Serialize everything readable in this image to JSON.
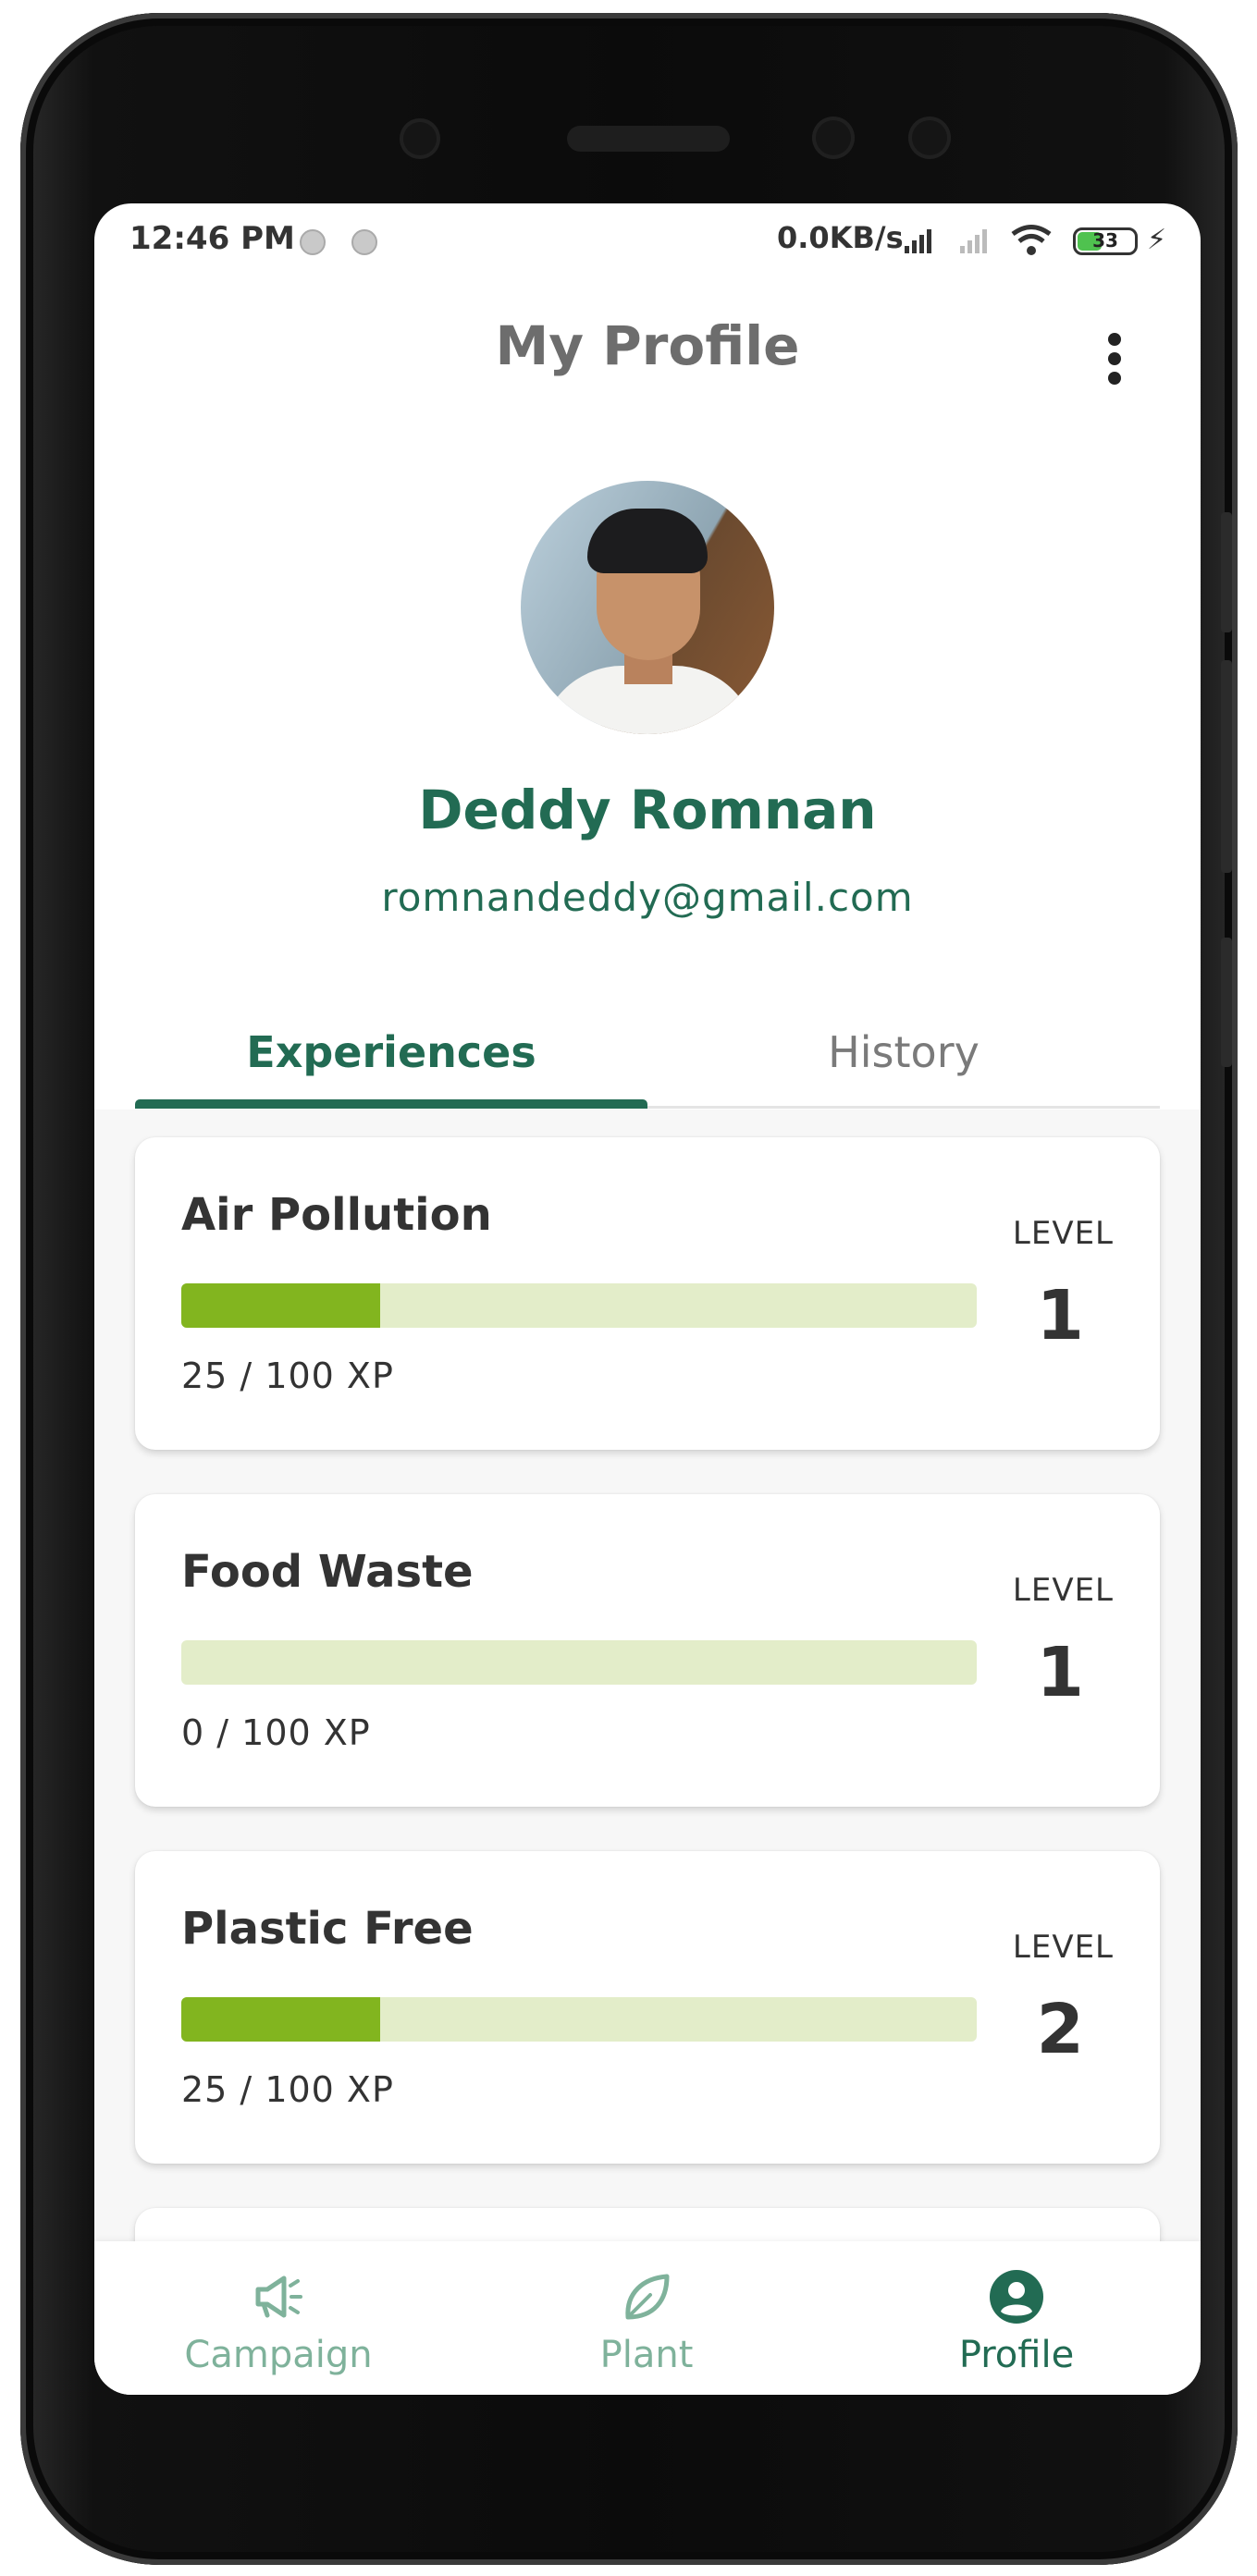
{
  "status_bar": {
    "time": "12:46 PM",
    "net_speed": "0.0KB/s",
    "battery": "33"
  },
  "header": {
    "title": "My Profile"
  },
  "profile": {
    "name": "Deddy Romnan",
    "email": "romnandeddy@gmail.com"
  },
  "tabs": [
    {
      "label": "Experiences",
      "active": true
    },
    {
      "label": "History",
      "active": false
    }
  ],
  "experiences": [
    {
      "title": "Air Pollution",
      "xp_text": "25 / 100 XP",
      "progress": 0.25,
      "level_label": "LEVEL",
      "level": "1"
    },
    {
      "title": "Food Waste",
      "xp_text": "0 / 100 XP",
      "progress": 0.0,
      "level_label": "LEVEL",
      "level": "1"
    },
    {
      "title": "Plastic Free",
      "xp_text": "25 / 100 XP",
      "progress": 0.25,
      "level_label": "LEVEL",
      "level": "2"
    }
  ],
  "bottom_nav": [
    {
      "label": "Campaign",
      "icon": "megaphone-icon",
      "active": false
    },
    {
      "label": "Plant",
      "icon": "leaf-icon",
      "active": false
    },
    {
      "label": "Profile",
      "icon": "account-circle-icon",
      "active": true
    }
  ],
  "colors": {
    "primary": "#226b53",
    "progress_fill": "#82b51f",
    "progress_track": "#e3edc9",
    "nav_inactive": "#7fb29b"
  }
}
